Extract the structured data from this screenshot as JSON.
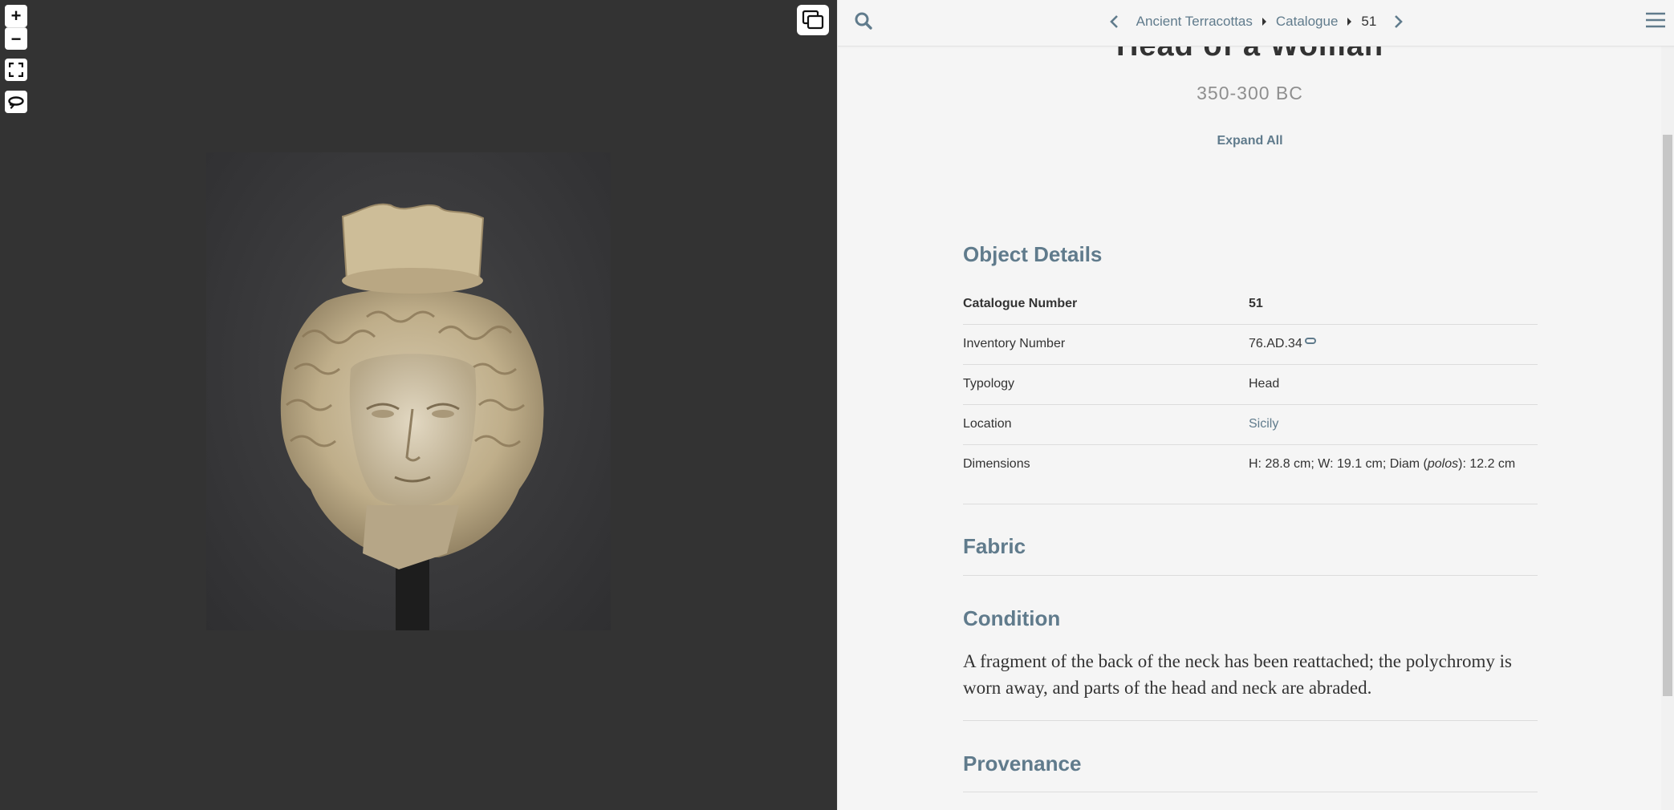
{
  "viewer": {
    "zoom_in_label": "+",
    "zoom_out_label": "−",
    "icons": [
      "fullscreen-icon",
      "rotate-icon",
      "layers-icon"
    ],
    "image_alt": "terracotta head of a woman wearing a polos"
  },
  "topbar": {
    "breadcrumb": {
      "section": "Ancient Terracottas",
      "subsection": "Catalogue",
      "current": "51"
    },
    "icons": [
      "search-icon",
      "chevron-left-icon",
      "chevron-right-icon",
      "hamburger-menu-icon"
    ]
  },
  "entry": {
    "title": "Head of a Woman",
    "date": "350-300 BC",
    "expand_all": "Expand All"
  },
  "object_details": {
    "heading": "Object Details",
    "rows": [
      {
        "key": "Catalogue Number",
        "value": "51"
      },
      {
        "key": "Inventory Number",
        "value": "76.AD.34"
      },
      {
        "key": "Typology",
        "value": "Head"
      },
      {
        "key": "Location",
        "value": "Sicily"
      },
      {
        "key": "Dimensions",
        "value_pre": "H: 28.8 cm; W: 19.1 cm; Diam (",
        "value_em": "polos",
        "value_post": "): 12.2 cm"
      }
    ]
  },
  "sections": {
    "fabric": "Fabric",
    "condition": "Condition",
    "condition_text": "A fragment of the back of the neck has been reattached; the polychromy is worn away, and parts of the head and neck are abraded.",
    "provenance": "Provenance"
  },
  "colors": {
    "accent": "#607b8c",
    "viewer_bg": "#333333",
    "reader_bg": "#f5f5f5",
    "text": "#333333"
  }
}
